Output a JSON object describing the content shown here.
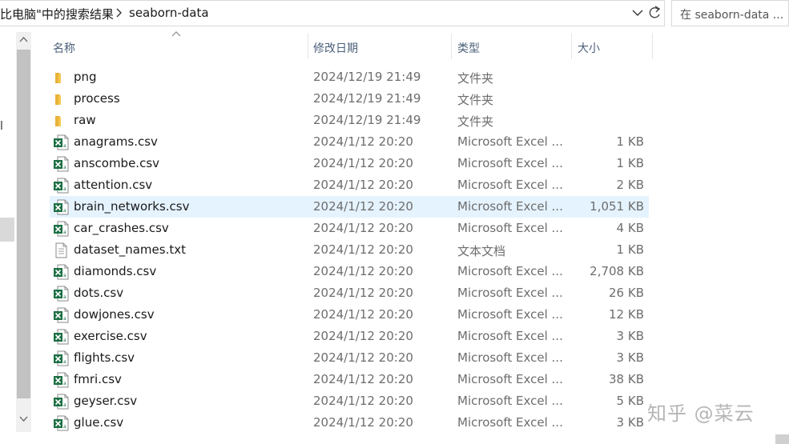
{
  "address_bar": {
    "breadcrumb_prev": "比电脑\"中的搜索结果",
    "breadcrumb_current": "seaborn-data"
  },
  "search": {
    "text": "在 seaborn-data ..."
  },
  "nav": {
    "mark": "l"
  },
  "columns": {
    "name": "名称",
    "date": "修改日期",
    "type": "类型",
    "size": "大小"
  },
  "files": [
    {
      "name": "png",
      "date": "2024/12/19 21:49",
      "type": "文件夹",
      "size": "",
      "icon": "folder-icon"
    },
    {
      "name": "process",
      "date": "2024/12/19 21:49",
      "type": "文件夹",
      "size": "",
      "icon": "folder-icon"
    },
    {
      "name": "raw",
      "date": "2024/12/19 21:49",
      "type": "文件夹",
      "size": "",
      "icon": "folder-icon"
    },
    {
      "name": "anagrams.csv",
      "date": "2024/1/12 20:20",
      "type": "Microsoft Excel ...",
      "size": "1 KB",
      "icon": "excel-csv-icon"
    },
    {
      "name": "anscombe.csv",
      "date": "2024/1/12 20:20",
      "type": "Microsoft Excel ...",
      "size": "1 KB",
      "icon": "excel-csv-icon"
    },
    {
      "name": "attention.csv",
      "date": "2024/1/12 20:20",
      "type": "Microsoft Excel ...",
      "size": "2 KB",
      "icon": "excel-csv-icon"
    },
    {
      "name": "brain_networks.csv",
      "date": "2024/1/12 20:20",
      "type": "Microsoft Excel ...",
      "size": "1,051 KB",
      "icon": "excel-csv-icon",
      "selected": true
    },
    {
      "name": "car_crashes.csv",
      "date": "2024/1/12 20:20",
      "type": "Microsoft Excel ...",
      "size": "4 KB",
      "icon": "excel-csv-icon"
    },
    {
      "name": "dataset_names.txt",
      "date": "2024/1/12 20:20",
      "type": "文本文档",
      "size": "1 KB",
      "icon": "text-document-icon"
    },
    {
      "name": "diamonds.csv",
      "date": "2024/1/12 20:20",
      "type": "Microsoft Excel ...",
      "size": "2,708 KB",
      "icon": "excel-csv-icon"
    },
    {
      "name": "dots.csv",
      "date": "2024/1/12 20:20",
      "type": "Microsoft Excel ...",
      "size": "26 KB",
      "icon": "excel-csv-icon"
    },
    {
      "name": "dowjones.csv",
      "date": "2024/1/12 20:20",
      "type": "Microsoft Excel ...",
      "size": "12 KB",
      "icon": "excel-csv-icon"
    },
    {
      "name": "exercise.csv",
      "date": "2024/1/12 20:20",
      "type": "Microsoft Excel ...",
      "size": "3 KB",
      "icon": "excel-csv-icon"
    },
    {
      "name": "flights.csv",
      "date": "2024/1/12 20:20",
      "type": "Microsoft Excel ...",
      "size": "3 KB",
      "icon": "excel-csv-icon"
    },
    {
      "name": "fmri.csv",
      "date": "2024/1/12 20:20",
      "type": "Microsoft Excel ...",
      "size": "38 KB",
      "icon": "excel-csv-icon"
    },
    {
      "name": "geyser.csv",
      "date": "2024/1/12 20:20",
      "type": "Microsoft Excel ...",
      "size": "5 KB",
      "icon": "excel-csv-icon"
    },
    {
      "name": "glue.csv",
      "date": "2024/1/12 20:20",
      "type": "Microsoft Excel ...",
      "size": "3 KB",
      "icon": "excel-csv-icon"
    }
  ],
  "watermark": {
    "text": "知乎 @菜云"
  },
  "colors": {
    "selected_row": "#e5f3ff",
    "folder": "#f6c94c",
    "excel_green": "#1d7044",
    "header_text": "#4c607a"
  }
}
